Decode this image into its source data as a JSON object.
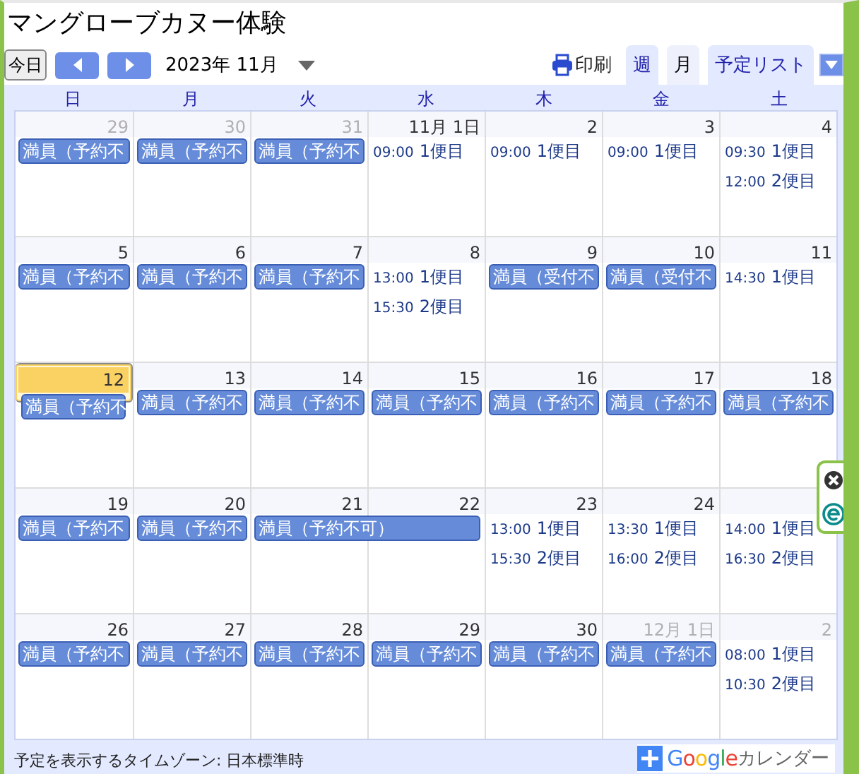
{
  "title": "マングローブカヌー体験",
  "toolbar": {
    "today": "今日",
    "period": "2023年 11月",
    "print": "印刷"
  },
  "tabs": [
    {
      "label": "週",
      "selected": false
    },
    {
      "label": "月",
      "selected": true
    },
    {
      "label": "予定リスト",
      "selected": false
    }
  ],
  "weekdays": [
    "日",
    "月",
    "火",
    "水",
    "木",
    "金",
    "土"
  ],
  "weeks": [
    {
      "days": [
        {
          "date": "29",
          "other_month": true,
          "today": false,
          "events": [
            {
              "kind": "bar",
              "title": "満員（予約不"
            }
          ]
        },
        {
          "date": "30",
          "other_month": true,
          "today": false,
          "events": [
            {
              "kind": "bar",
              "title": "満員（予約不"
            }
          ]
        },
        {
          "date": "31",
          "other_month": true,
          "today": false,
          "events": [
            {
              "kind": "bar",
              "title": "満員（予約不"
            }
          ]
        },
        {
          "date": "11月 1日",
          "other_month": false,
          "today": false,
          "events": [
            {
              "kind": "timed",
              "time": "09:00",
              "title": "1便目"
            }
          ]
        },
        {
          "date": "2",
          "other_month": false,
          "today": false,
          "events": [
            {
              "kind": "timed",
              "time": "09:00",
              "title": "1便目"
            }
          ]
        },
        {
          "date": "3",
          "other_month": false,
          "today": false,
          "events": [
            {
              "kind": "timed",
              "time": "09:00",
              "title": "1便目"
            }
          ]
        },
        {
          "date": "4",
          "other_month": false,
          "today": false,
          "events": [
            {
              "kind": "timed",
              "time": "09:30",
              "title": "1便目"
            },
            {
              "kind": "timed",
              "time": "12:00",
              "title": "2便目"
            }
          ]
        }
      ]
    },
    {
      "days": [
        {
          "date": "5",
          "other_month": false,
          "today": false,
          "events": [
            {
              "kind": "bar",
              "title": "満員（予約不"
            }
          ]
        },
        {
          "date": "6",
          "other_month": false,
          "today": false,
          "events": [
            {
              "kind": "bar",
              "title": "満員（予約不"
            }
          ]
        },
        {
          "date": "7",
          "other_month": false,
          "today": false,
          "events": [
            {
              "kind": "bar",
              "title": "満員（予約不"
            }
          ]
        },
        {
          "date": "8",
          "other_month": false,
          "today": false,
          "events": [
            {
              "kind": "timed",
              "time": "13:00",
              "title": "1便目"
            },
            {
              "kind": "timed",
              "time": "15:30",
              "title": "2便目"
            }
          ]
        },
        {
          "date": "9",
          "other_month": false,
          "today": false,
          "events": [
            {
              "kind": "bar",
              "title": "満員（受付不"
            }
          ]
        },
        {
          "date": "10",
          "other_month": false,
          "today": false,
          "events": [
            {
              "kind": "bar",
              "title": "満員（受付不"
            }
          ]
        },
        {
          "date": "11",
          "other_month": false,
          "today": false,
          "events": [
            {
              "kind": "timed",
              "time": "14:30",
              "title": "1便目"
            }
          ]
        }
      ]
    },
    {
      "days": [
        {
          "date": "12",
          "other_month": false,
          "today": true,
          "events": [
            {
              "kind": "bar",
              "title": "満員（予約不"
            }
          ]
        },
        {
          "date": "13",
          "other_month": false,
          "today": false,
          "events": [
            {
              "kind": "bar",
              "title": "満員（予約不"
            }
          ]
        },
        {
          "date": "14",
          "other_month": false,
          "today": false,
          "events": [
            {
              "kind": "bar",
              "title": "満員（予約不"
            }
          ]
        },
        {
          "date": "15",
          "other_month": false,
          "today": false,
          "events": [
            {
              "kind": "bar",
              "title": "満員（予約不"
            }
          ]
        },
        {
          "date": "16",
          "other_month": false,
          "today": false,
          "events": [
            {
              "kind": "bar",
              "title": "満員（予約不"
            }
          ]
        },
        {
          "date": "17",
          "other_month": false,
          "today": false,
          "events": [
            {
              "kind": "bar",
              "title": "満員（予約不"
            }
          ]
        },
        {
          "date": "18",
          "other_month": false,
          "today": false,
          "events": [
            {
              "kind": "bar",
              "title": "満員（予約不"
            }
          ]
        }
      ]
    },
    {
      "days": [
        {
          "date": "19",
          "other_month": false,
          "today": false,
          "events": [
            {
              "kind": "bar",
              "title": "満員（予約不"
            }
          ]
        },
        {
          "date": "20",
          "other_month": false,
          "today": false,
          "events": [
            {
              "kind": "bar",
              "title": "満員（予約不"
            }
          ]
        },
        {
          "date": "21",
          "other_month": false,
          "today": false,
          "events": [
            {
              "kind": "wide",
              "title": "満員（予約不可）"
            }
          ]
        },
        {
          "date": "22",
          "other_month": false,
          "today": false
        },
        {
          "date": "23",
          "other_month": false,
          "today": false,
          "events": [
            {
              "kind": "timed",
              "time": "13:00",
              "title": "1便目"
            },
            {
              "kind": "timed",
              "time": "15:30",
              "title": "2便目"
            }
          ]
        },
        {
          "date": "24",
          "other_month": false,
          "today": false,
          "events": [
            {
              "kind": "timed",
              "time": "13:30",
              "title": "1便目"
            },
            {
              "kind": "timed",
              "time": "16:00",
              "title": "2便目"
            }
          ]
        },
        {
          "today": false,
          "events": [
            {
              "kind": "timed",
              "time": "14:00",
              "title": "1便目"
            },
            {
              "kind": "timed",
              "time": "16:30",
              "title": "2便目"
            }
          ]
        }
      ]
    },
    {
      "days": [
        {
          "date": "26",
          "other_month": false,
          "today": false,
          "events": [
            {
              "kind": "bar",
              "title": "満員（予約不"
            }
          ]
        },
        {
          "date": "27",
          "other_month": false,
          "today": false,
          "events": [
            {
              "kind": "bar",
              "title": "満員（予約不"
            }
          ]
        },
        {
          "date": "28",
          "other_month": false,
          "today": false,
          "events": [
            {
              "kind": "bar",
              "title": "満員（予約不"
            }
          ]
        },
        {
          "date": "29",
          "other_month": false,
          "today": false,
          "events": [
            {
              "kind": "bar",
              "title": "満員（予約不"
            }
          ]
        },
        {
          "date": "30",
          "other_month": false,
          "today": false,
          "events": [
            {
              "kind": "bar",
              "title": "満員（予約不"
            }
          ]
        },
        {
          "date": "12月 1日",
          "other_month": true,
          "today": false,
          "events": [
            {
              "kind": "bar",
              "title": "満員（予約不"
            }
          ]
        },
        {
          "date": "2",
          "other_month": true,
          "today": false,
          "events": [
            {
              "kind": "timed",
              "time": "08:00",
              "title": "1便目"
            },
            {
              "kind": "timed",
              "time": "10:30",
              "title": "2便目"
            }
          ]
        }
      ]
    }
  ],
  "footer": {
    "timezone": "予定を表示するタイムゾーン: 日本標準時",
    "brand": "Google",
    "calendar": "カレンダー"
  }
}
